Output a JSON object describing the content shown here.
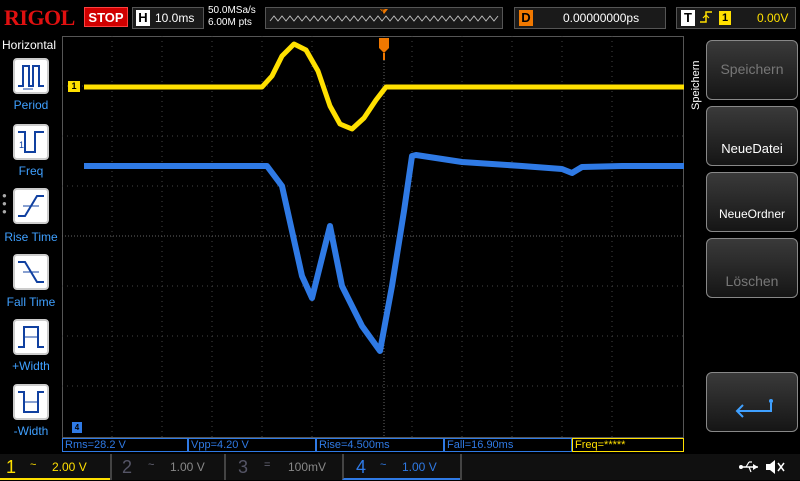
{
  "brand": {
    "logo": "RIGOL",
    "run_state": "STOP"
  },
  "horizontal": {
    "letter": "H",
    "timebase": "10.0ms",
    "sample_rate": "50.0MSa/s",
    "memory_depth": "6.00M pts"
  },
  "delay": {
    "letter": "D",
    "value": "0.00000000ps"
  },
  "trigger": {
    "letter": "T",
    "source": "1",
    "level": "0.00V",
    "marker": "T"
  },
  "left_panel": {
    "title": "Horizontal",
    "items": [
      {
        "label": "Period",
        "icon": "period-icon"
      },
      {
        "label": "Freq",
        "icon": "frequency-icon"
      },
      {
        "label": "Rise Time",
        "icon": "rise-time-icon"
      },
      {
        "label": "Fall Time",
        "icon": "fall-time-icon"
      },
      {
        "label": "+Width",
        "icon": "positive-width-icon"
      },
      {
        "label": "-Width",
        "icon": "negative-width-icon"
      }
    ]
  },
  "right_menu": {
    "title": "Speichern",
    "items": [
      {
        "label": "Speichern",
        "enabled": false
      },
      {
        "label": "NeueDatei",
        "enabled": true
      },
      {
        "label": "NeueOrdner",
        "enabled": true
      },
      {
        "label": "Löschen",
        "enabled": false
      },
      {
        "label": "",
        "icon": "return-arrow-icon"
      }
    ]
  },
  "measurements": [
    {
      "text": "Rms=28.2 V"
    },
    {
      "text": "Vpp=4.20 V"
    },
    {
      "text": "Rise=4.500ms"
    },
    {
      "text": "Fall=16.90ms"
    },
    {
      "text": "Freq=*****"
    }
  ],
  "channels": [
    {
      "number": "1",
      "coupling": "~",
      "scale": "2.00 V",
      "color": "#ffe000",
      "active": true
    },
    {
      "number": "2",
      "coupling": "~",
      "scale": "1.00 V",
      "color": "#2bd4c4",
      "active": false
    },
    {
      "number": "3",
      "coupling": "=",
      "scale": "100mV",
      "color": "#d030d0",
      "active": false
    },
    {
      "number": "4",
      "coupling": "~",
      "scale": "1.00 V",
      "color": "#2f7ae5",
      "active": true
    }
  ],
  "waveform_markers": {
    "ch1_ground": "1",
    "ch4_ground": "4"
  },
  "status_icons": [
    "usb-icon",
    "speaker-mute-icon"
  ],
  "colors": {
    "ch1": "#ffe000",
    "ch4": "#2f7ae5",
    "trigger": "#f07800",
    "stop": "#d00000"
  }
}
